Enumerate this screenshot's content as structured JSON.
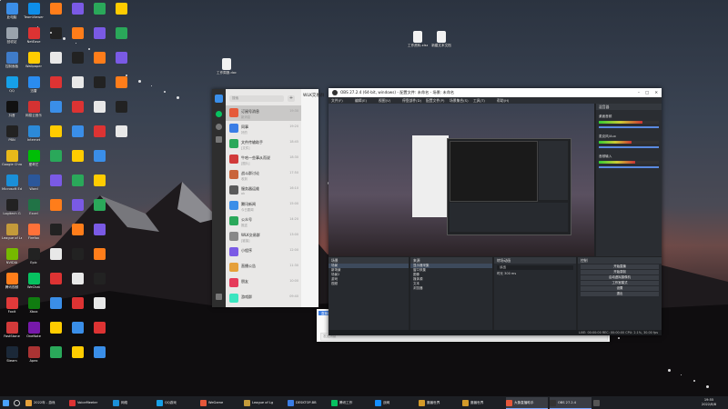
{
  "desktop": {
    "icons": [
      {
        "label": "此电脑",
        "color": "#3b8ee8"
      },
      {
        "label": "回收站",
        "color": "#9aa3ad"
      },
      {
        "label": "控制面板",
        "color": "#3f7cc9"
      },
      {
        "label": "QQ",
        "color": "#16a0e8"
      },
      {
        "label": "抖音",
        "color": "#111"
      },
      {
        "label": "PBN",
        "color": "#222"
      },
      {
        "label": "Google Chrome",
        "color": "#e8b91a"
      },
      {
        "label": "Microsoft Edge",
        "color": "#1a8fd8"
      },
      {
        "label": "Logitech G",
        "color": "#222"
      },
      {
        "label": "League of Legends",
        "color": "#c49a3a"
      },
      {
        "label": "NVIDIA",
        "color": "#76b900"
      },
      {
        "label": "腾讯视频",
        "color": "#ff7d1a"
      },
      {
        "label": "Foxit",
        "color": "#e03a3a"
      },
      {
        "label": "FastStone",
        "color": "#d23a3a"
      },
      {
        "label": "Steam",
        "color": "#1b2838"
      },
      {
        "label": "TeamViewer",
        "color": "#0e8ee9"
      },
      {
        "label": "NetEase",
        "color": "#d33"
      },
      {
        "label": "Wallpaper",
        "color": "#ffcc00"
      },
      {
        "label": "迅雷",
        "color": "#2a8cf0"
      },
      {
        "label": "网易云音乐",
        "color": "#d53232"
      },
      {
        "label": "Internet",
        "color": "#2c8ad8"
      },
      {
        "label": "爱奇艺",
        "color": "#00be06"
      },
      {
        "label": "Word",
        "color": "#2b579a"
      },
      {
        "label": "Excel",
        "color": "#217346"
      },
      {
        "label": "Firefox",
        "color": "#ff7139"
      },
      {
        "label": "Epic",
        "color": "#222"
      },
      {
        "label": "WeChat",
        "color": "#07c160"
      },
      {
        "label": "Xbox",
        "color": "#107c10"
      },
      {
        "label": "OneNote",
        "color": "#7719aa"
      },
      {
        "label": "Apex",
        "color": "#a33"
      }
    ],
    "files": [
      "工作周报.docx",
      "工作资料.xlsx",
      "新建文本文档"
    ],
    "snow_count": 40
  },
  "wechat": {
    "title": "WLK交易群",
    "search_placeholder": "搜索",
    "chats": [
      {
        "name": "订阅号消息",
        "preview": "新消息",
        "time": "19:30",
        "avatar": "#e55a3a"
      },
      {
        "name": "同事",
        "preview": "好的",
        "time": "19:20",
        "avatar": "#3a7de5"
      },
      {
        "name": "文件传输助手",
        "preview": "[文件]",
        "time": "18:45",
        "avatar": "#2aa85a"
      },
      {
        "name": "牛哈一些事从而说",
        "preview": "[图片]",
        "time": "18:30",
        "avatar": "#d13a3a"
      },
      {
        "name": "战斗群讨论",
        "preview": "收到",
        "time": "17:50",
        "avatar": "#c9643a"
      },
      {
        "name": "服务器运维",
        "preview": "ok",
        "time": "16:10",
        "avatar": "#5a5a5a"
      },
      {
        "name": "腾讯新闻",
        "preview": "今日要闻",
        "time": "15:00",
        "avatar": "#3a8ee8"
      },
      {
        "name": "公众号",
        "preview": "推送",
        "time": "14:20",
        "avatar": "#2aa85a"
      },
      {
        "name": "WLK交易群",
        "preview": "[链接]",
        "time": "13:00",
        "avatar": "#888"
      },
      {
        "name": "小程序",
        "preview": "",
        "time": "12:00",
        "avatar": "#7a5ae5"
      },
      {
        "name": "直播公告",
        "preview": "",
        "time": "11:30",
        "avatar": "#e5a03a"
      },
      {
        "name": "朋友",
        "preview": "",
        "time": "10:00",
        "avatar": "#e53a5a"
      },
      {
        "name": "游戏群",
        "preview": "",
        "time": "09:40",
        "avatar": "#3ae5c0"
      }
    ]
  },
  "obs": {
    "title": "OBS 27.2.4 (64-bit, windows) - 配置文件: 未命名 - 场景: 未命名",
    "menu": [
      "文件(F)",
      "编辑(E)",
      "视图(V)",
      "停靠部件(D)",
      "配置文件(P)",
      "场景集合(S)",
      "工具(T)",
      "帮助(H)"
    ],
    "mixer_title": "混音器",
    "mixer_tracks": [
      {
        "name": "桌面音频",
        "level": 0.72
      },
      {
        "name": "麦克风/Aux",
        "level": 0.55
      },
      {
        "name": "音频输入",
        "level": 0.6
      }
    ],
    "panels": {
      "scenes": {
        "title": "场景",
        "items": [
          "场景",
          "新场景",
          "场景2",
          "游戏",
          "视频"
        ]
      },
      "sources": {
        "title": "来源",
        "items": [
          "显示器采集",
          "窗口采集",
          "图像",
          "媒体源",
          "文本",
          "浏览器"
        ]
      },
      "transitions": {
        "title": "转场动画",
        "fade": "淡出",
        "duration_label": "时长",
        "duration": "300 ms"
      },
      "controls": {
        "title": "控制",
        "buttons": [
          "开始直播",
          "开始录制",
          "启动虚拟摄像机",
          "工作室模式",
          "设置",
          "退出"
        ]
      }
    },
    "status": "LIVE: 00:00:00  REC: 00:00:00  CPU: 2.1%, 30.00 fps"
  },
  "browser": {
    "tabs": [
      "直播间DP1",
      "直播间DP2",
      "图片",
      "图片",
      "直播间DP3"
    ],
    "input_placeholder": "发送消息"
  },
  "taskbar": {
    "items": [
      {
        "label": "2022年 - 游戏",
        "color": "#e5a03a"
      },
      {
        "label": "VoiceMeeter",
        "color": "#d33"
      },
      {
        "label": "网络",
        "color": "#1a8fd8"
      },
      {
        "label": "QQ游戏",
        "color": "#16a0e8"
      },
      {
        "label": "WeGame",
        "color": "#e5573a"
      },
      {
        "label": "League of Lg",
        "color": "#c49a3a"
      },
      {
        "label": "DESKTOP-BB",
        "color": "#3a7de5"
      },
      {
        "label": "腾讯工作",
        "color": "#07c160"
      },
      {
        "label": "战网",
        "color": "#148eff"
      },
      {
        "label": "魔兽世界",
        "color": "#d39a2a"
      },
      {
        "label": "魔兽世界",
        "color": "#d39a2a"
      },
      {
        "label": "大象直播助手",
        "color": "#e5573a"
      },
      {
        "label": "OBS 27.2.4",
        "color": "#333"
      },
      {
        "label": "",
        "color": "#555"
      }
    ],
    "time": "19:55",
    "date": "2022/8/8"
  }
}
